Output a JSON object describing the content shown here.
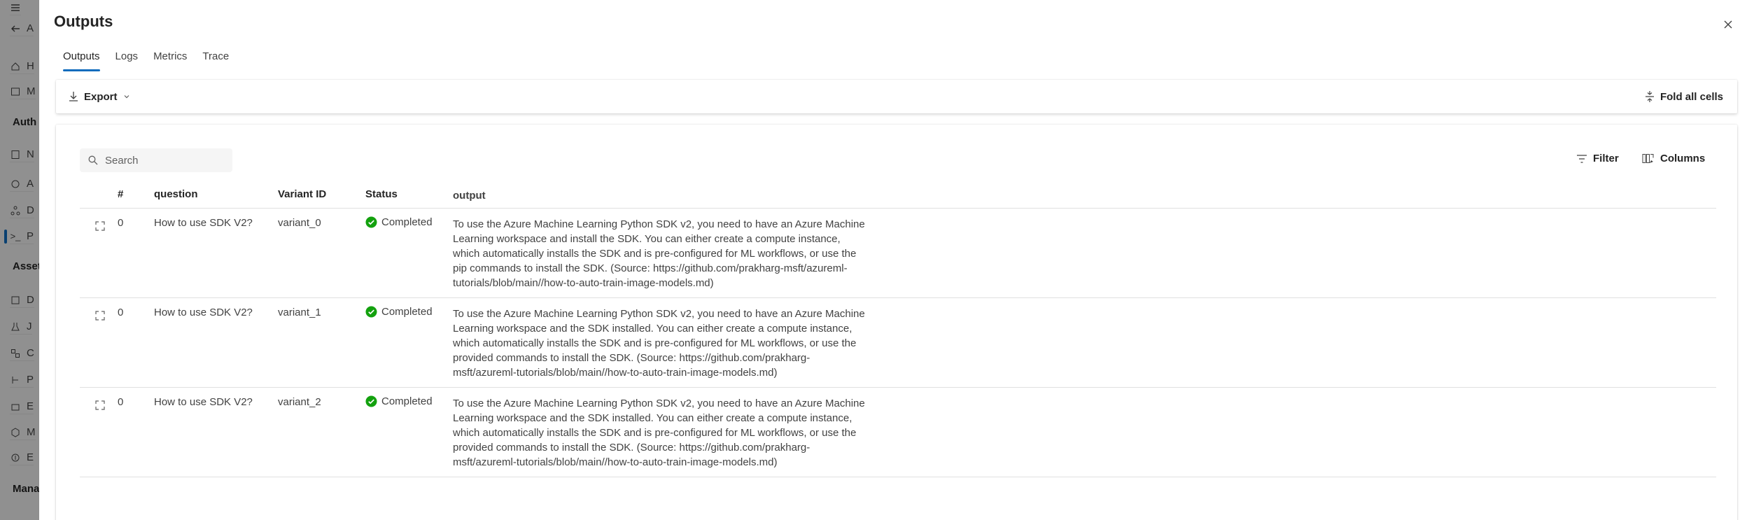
{
  "panel": {
    "title": "Outputs",
    "tabs": [
      {
        "label": "Outputs",
        "active": true
      },
      {
        "label": "Logs",
        "active": false
      },
      {
        "label": "Metrics",
        "active": false
      },
      {
        "label": "Trace",
        "active": false
      }
    ]
  },
  "toolbar": {
    "export_label": "Export",
    "fold_label": "Fold all cells"
  },
  "grid": {
    "search_placeholder": "Search",
    "filter_label": "Filter",
    "columns_label": "Columns",
    "headers": {
      "num": "#",
      "question": "question",
      "variant": "Variant ID",
      "status": "Status",
      "output": "output"
    },
    "rows": [
      {
        "num": "0",
        "question": "How to use SDK V2?",
        "variant": "variant_0",
        "status": "Completed",
        "output": "To use the Azure Machine Learning Python SDK v2, you need to have an Azure Machine Learning workspace and install the SDK. You can either create a compute instance, which automatically installs the SDK and is pre-configured for ML workflows, or use the pip commands to install the SDK. (Source: https://github.com/prakharg-msft/azureml-tutorials/blob/main//how-to-auto-train-image-models.md)"
      },
      {
        "num": "0",
        "question": "How to use SDK V2?",
        "variant": "variant_1",
        "status": "Completed",
        "output": "To use the Azure Machine Learning Python SDK v2, you need to have an Azure Machine Learning workspace and the SDK installed. You can either create a compute instance, which automatically installs the SDK and is pre-configured for ML workflows, or use the provided commands to install the SDK. (Source: https://github.com/prakharg-msft/azureml-tutorials/blob/main//how-to-auto-train-image-models.md)"
      },
      {
        "num": "0",
        "question": "How to use SDK V2?",
        "variant": "variant_2",
        "status": "Completed",
        "output": "To use the Azure Machine Learning Python SDK v2, you need to have an Azure Machine Learning workspace and the SDK installed. You can either create a compute instance, which automatically installs the SDK and is pre-configured for ML workflows, or use the provided commands to install the SDK. (Source: https://github.com/prakharg-msft/azureml-tutorials/blob/main//how-to-auto-train-image-models.md)"
      }
    ]
  },
  "background_nav": {
    "items": [
      {
        "label": "H",
        "icon": "home-icon"
      },
      {
        "label": "M",
        "icon": "model-catalog-icon"
      },
      {
        "label": "Auth",
        "section": true
      },
      {
        "label": "N",
        "icon": "notebook-icon"
      },
      {
        "label": "A",
        "icon": "automl-icon"
      },
      {
        "label": "D",
        "icon": "designer-icon"
      },
      {
        "label": "P",
        "icon": "prompt-flow-icon",
        "selected": true
      },
      {
        "label": "Asset",
        "section": true
      },
      {
        "label": "D",
        "icon": "data-icon"
      },
      {
        "label": "J",
        "icon": "jobs-icon"
      },
      {
        "label": "C",
        "icon": "components-icon"
      },
      {
        "label": "P",
        "icon": "pipelines-icon"
      },
      {
        "label": "E",
        "icon": "environments-icon"
      },
      {
        "label": "M",
        "icon": "models-icon"
      },
      {
        "label": "E",
        "icon": "endpoints-icon"
      },
      {
        "label": "Mana",
        "section": true
      }
    ]
  },
  "colors": {
    "accent": "#0f6cbd",
    "success": "#13a10e"
  }
}
